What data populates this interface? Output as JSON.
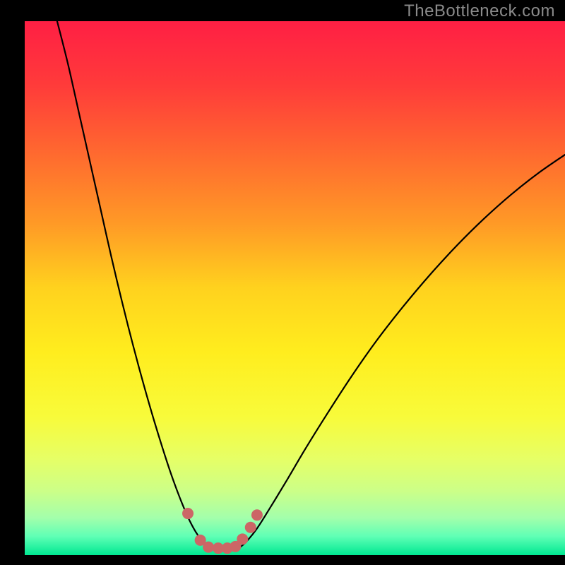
{
  "watermark": "TheBottleneck.com",
  "chart_data": {
    "type": "line",
    "title": "",
    "xlabel": "",
    "ylabel": "",
    "x_range": [
      0,
      100
    ],
    "y_range": [
      0,
      100
    ],
    "background_gradient": {
      "stops": [
        {
          "offset": 0.0,
          "color": "#ff1f44"
        },
        {
          "offset": 0.12,
          "color": "#ff3b3a"
        },
        {
          "offset": 0.25,
          "color": "#ff6a2f"
        },
        {
          "offset": 0.38,
          "color": "#ff9a26"
        },
        {
          "offset": 0.5,
          "color": "#ffd21e"
        },
        {
          "offset": 0.62,
          "color": "#ffed1e"
        },
        {
          "offset": 0.74,
          "color": "#f8fb3a"
        },
        {
          "offset": 0.82,
          "color": "#e6ff66"
        },
        {
          "offset": 0.88,
          "color": "#ccff88"
        },
        {
          "offset": 0.93,
          "color": "#a3ffab"
        },
        {
          "offset": 0.965,
          "color": "#5fffb5"
        },
        {
          "offset": 1.0,
          "color": "#00e892"
        }
      ]
    },
    "series": [
      {
        "name": "left-curve",
        "color": "#000000",
        "width": 2.2,
        "points": [
          {
            "x": 6.0,
            "y": 100.0
          },
          {
            "x": 8.0,
            "y": 92.0
          },
          {
            "x": 10.0,
            "y": 83.0
          },
          {
            "x": 12.0,
            "y": 74.0
          },
          {
            "x": 14.0,
            "y": 65.0
          },
          {
            "x": 16.0,
            "y": 56.0
          },
          {
            "x": 18.0,
            "y": 47.5
          },
          {
            "x": 20.0,
            "y": 39.5
          },
          {
            "x": 22.0,
            "y": 32.0
          },
          {
            "x": 24.0,
            "y": 25.0
          },
          {
            "x": 26.0,
            "y": 18.5
          },
          {
            "x": 27.5,
            "y": 14.0
          },
          {
            "x": 29.0,
            "y": 10.0
          },
          {
            "x": 30.5,
            "y": 6.5
          },
          {
            "x": 32.0,
            "y": 3.8
          },
          {
            "x": 33.5,
            "y": 2.0
          },
          {
            "x": 35.0,
            "y": 1.2
          }
        ]
      },
      {
        "name": "right-curve",
        "color": "#000000",
        "width": 2.2,
        "points": [
          {
            "x": 39.5,
            "y": 1.2
          },
          {
            "x": 41.0,
            "y": 2.5
          },
          {
            "x": 43.0,
            "y": 5.0
          },
          {
            "x": 45.5,
            "y": 9.0
          },
          {
            "x": 48.5,
            "y": 14.0
          },
          {
            "x": 52.0,
            "y": 20.0
          },
          {
            "x": 56.0,
            "y": 26.5
          },
          {
            "x": 60.5,
            "y": 33.5
          },
          {
            "x": 65.0,
            "y": 40.0
          },
          {
            "x": 70.0,
            "y": 46.5
          },
          {
            "x": 75.0,
            "y": 52.5
          },
          {
            "x": 80.0,
            "y": 58.0
          },
          {
            "x": 85.0,
            "y": 63.0
          },
          {
            "x": 90.0,
            "y": 67.5
          },
          {
            "x": 95.0,
            "y": 71.5
          },
          {
            "x": 100.0,
            "y": 75.0
          }
        ]
      }
    ],
    "markers": {
      "name": "bottom-highlight-markers",
      "color": "#cc6666",
      "radius": 8,
      "points": [
        {
          "x": 30.2,
          "y": 7.8
        },
        {
          "x": 32.5,
          "y": 2.8
        },
        {
          "x": 34.0,
          "y": 1.5
        },
        {
          "x": 35.8,
          "y": 1.3
        },
        {
          "x": 37.5,
          "y": 1.3
        },
        {
          "x": 39.0,
          "y": 1.6
        },
        {
          "x": 40.3,
          "y": 3.0
        },
        {
          "x": 41.8,
          "y": 5.2
        },
        {
          "x": 43.0,
          "y": 7.5
        }
      ]
    }
  }
}
